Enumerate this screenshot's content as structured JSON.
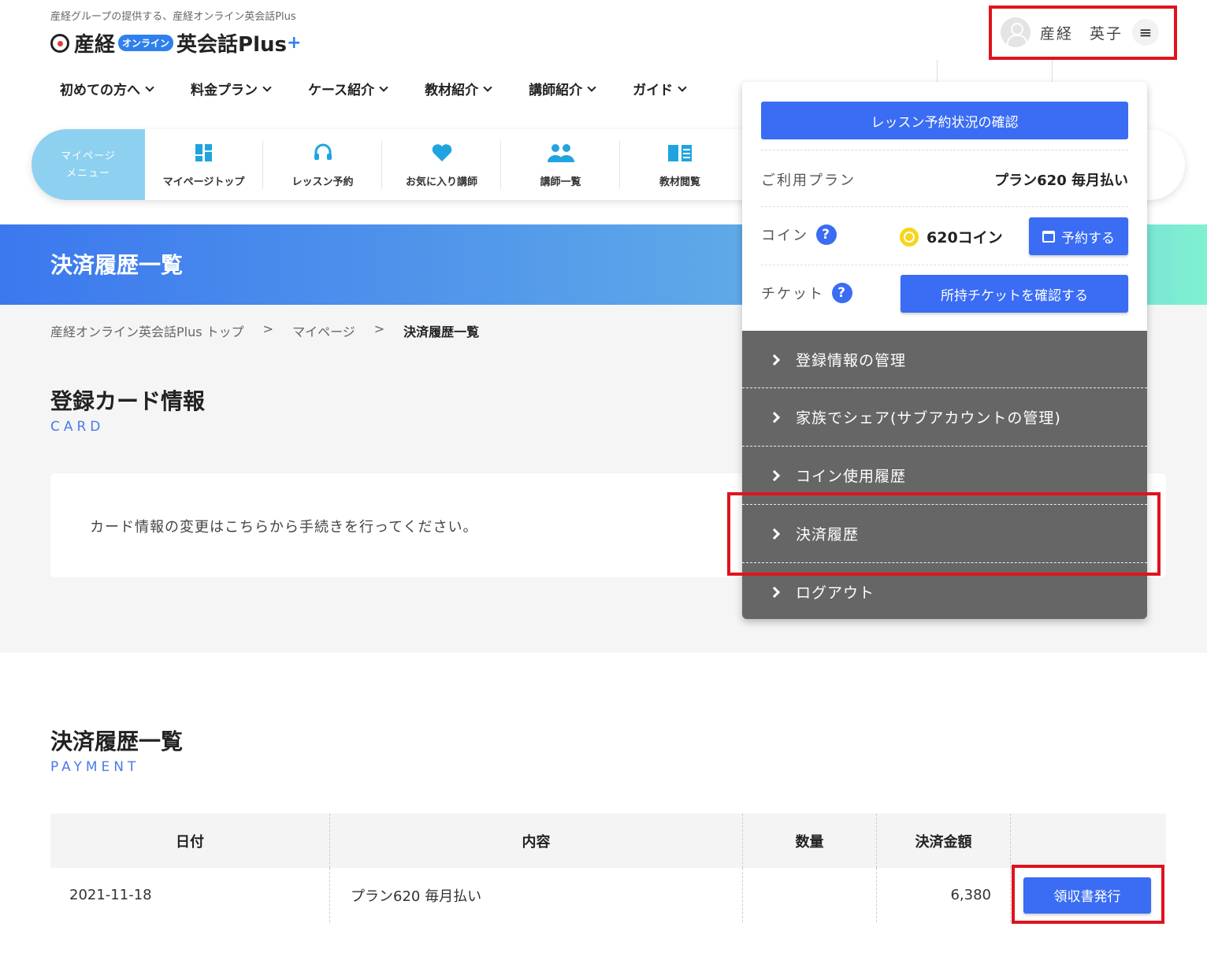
{
  "header": {
    "tagline": "産経グループの提供する、産経オンライン英会話Plus",
    "logo_main": "産経",
    "logo_online": "オンライン",
    "logo_rest": "英会話Plus",
    "logo_plus": "+",
    "user_name": "産経　英子",
    "menu_icon": "hamburger-icon"
  },
  "nav": [
    {
      "label": "初めての方へ"
    },
    {
      "label": "料金プラン"
    },
    {
      "label": "ケース紹介"
    },
    {
      "label": "教材紹介"
    },
    {
      "label": "講師紹介"
    },
    {
      "label": "ガイド"
    }
  ],
  "mypage": {
    "label_line1": "マイページ",
    "label_line2": "メニュー",
    "items": [
      {
        "label": "マイページトップ",
        "icon": "dashboard-icon"
      },
      {
        "label": "レッスン予約",
        "icon": "headset-icon"
      },
      {
        "label": "お気に入り講師",
        "icon": "heart-icon"
      },
      {
        "label": "講師一覧",
        "icon": "people-icon"
      },
      {
        "label": "教材閲覧",
        "icon": "book-icon"
      }
    ]
  },
  "hero": {
    "title": "決済履歴一覧"
  },
  "breadcrumb": {
    "top": "産経オンライン英会話Plus トップ",
    "sep": ">",
    "mypage": "マイページ",
    "current": "決済履歴一覧"
  },
  "card_section": {
    "title": "登録カード情報",
    "sub": "CARD",
    "text": "カード情報の変更はこちらから手続きを行ってください。"
  },
  "payment_section": {
    "title": "決済履歴一覧",
    "sub": "PAYMENT",
    "headers": [
      "日付",
      "内容",
      "数量",
      "決済金額",
      ""
    ],
    "rows": [
      {
        "date": "2021-11-18",
        "content": "プラン620 毎月払い",
        "qty": "",
        "amount": "6,380",
        "button": "領収書発行"
      }
    ]
  },
  "dropdown": {
    "top_button": "レッスン予約状況の確認",
    "plan_label": "ご利用プラン",
    "plan_value": "プラン620 毎月払い",
    "coin_label": "コイン",
    "coin_value": "620コイン",
    "reserve_button": "予約する",
    "ticket_label": "チケット",
    "ticket_button": "所持チケットを確認する",
    "help_mark": "?",
    "menu": [
      {
        "label": "登録情報の管理"
      },
      {
        "label": "家族でシェア(サブアカウントの管理)"
      },
      {
        "label": "コイン使用履歴"
      },
      {
        "label": "決済履歴"
      },
      {
        "label": "ログアウト"
      }
    ]
  },
  "colors": {
    "accent": "#3a6cf4",
    "highlight": "#e0131e",
    "menu_bg": "#666666",
    "mypage_label_bg": "#8ed0f0"
  }
}
